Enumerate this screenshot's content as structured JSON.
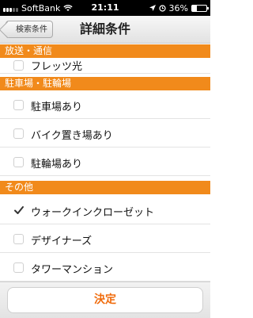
{
  "status_bar": {
    "carrier": "SoftBank",
    "time": "21:11",
    "battery_percent_label": "36%",
    "battery_level": 0.36
  },
  "nav": {
    "back_label": "検索条件",
    "title": "詳細条件"
  },
  "sections": [
    {
      "title": "放送・通信",
      "items": [
        {
          "label": "フレッツ光",
          "checked": false
        }
      ]
    },
    {
      "title": "駐車場・駐輪場",
      "items": [
        {
          "label": "駐車場あり",
          "checked": false
        },
        {
          "label": "バイク置き場あり",
          "checked": false
        },
        {
          "label": "駐輪場あり",
          "checked": false
        }
      ]
    },
    {
      "title": "その他",
      "items": [
        {
          "label": "ウォークインクローゼット",
          "checked": true
        },
        {
          "label": "デザイナーズ",
          "checked": false
        },
        {
          "label": "タワーマンション",
          "checked": false
        }
      ]
    }
  ],
  "footer": {
    "decide_label": "決定"
  },
  "colors": {
    "accent": "#f18a1b",
    "decide_text": "#f06b0c"
  }
}
